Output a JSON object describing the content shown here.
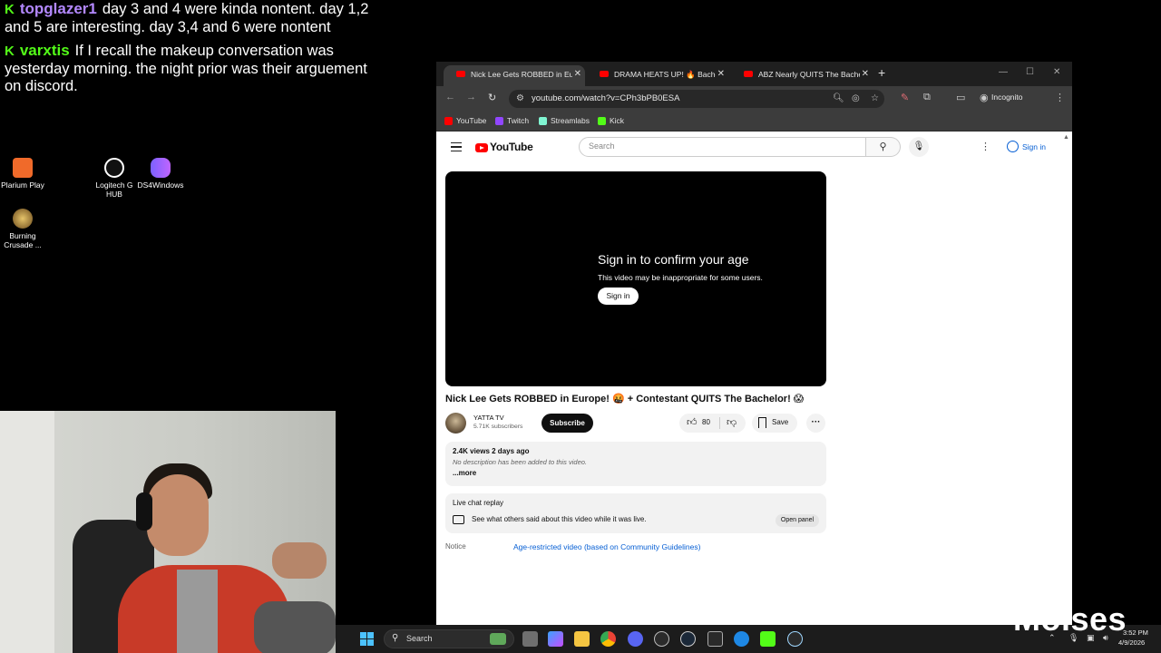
{
  "chat": {
    "messages": [
      {
        "user": "topglazer1",
        "text": "day 3 and 4 were kinda nontent. day 1,2 and 5 are interesting. day 3,4 and 6 were nontent"
      },
      {
        "user": "varxtis",
        "text": "If I recall the makeup conversation was yesterday morning. the night prior was their arguement on discord."
      }
    ]
  },
  "desktop": {
    "icons": [
      {
        "label": "Plarium Play",
        "color": "#f06a2a"
      },
      {
        "label": "Logitech G HUB",
        "color": "#ffffff"
      },
      {
        "label": "DS4Windows",
        "color": "#7b61ff"
      },
      {
        "label": "Burning Crusade ...",
        "color": "#c9a24b"
      }
    ]
  },
  "browser": {
    "tabs": [
      {
        "title": "Nick Lee Gets ROBBED in Europe!",
        "active": true
      },
      {
        "title": "DRAMA HEATS UP! 🔥 Bachelor",
        "active": false
      },
      {
        "title": "ABZ Nearly QUITS The Bachelor",
        "active": false
      }
    ],
    "new_tab": "+",
    "url": "youtube.com/watch?v=CPh3bPB0ESA",
    "incognito_label": "Incognito",
    "bookmarks": [
      {
        "label": "YouTube",
        "color": "#ff0000"
      },
      {
        "label": "Twitch",
        "color": "#9146ff"
      },
      {
        "label": "Streamlabs",
        "color": "#80f5d2"
      },
      {
        "label": "Kick",
        "color": "#53fc18"
      }
    ]
  },
  "youtube": {
    "logo_text": "YouTube",
    "search_placeholder": "Search",
    "sign_in_label": "Sign in",
    "player": {
      "title": "Sign in to confirm your age",
      "subtitle": "This video may be inappropriate for some users.",
      "button": "Sign in"
    },
    "video_title": "Nick Lee Gets ROBBED in Europe! 🤬 + Contestant QUITS The Bachelor! 😱",
    "channel": {
      "name": "YATTA TV",
      "subscribers": "5.71K subscribers"
    },
    "subscribe_label": "Subscribe",
    "like_count": "80",
    "save_label": "Save",
    "description": {
      "stats": "2.4K views  2 days ago",
      "text": "No description has been added to this video.",
      "more": "...more"
    },
    "live_chat": {
      "title": "Live chat replay",
      "text": "See what others said about this video while it was live.",
      "button": "Open panel"
    },
    "notice": {
      "label": "Notice",
      "link": "Age-restricted video (based on Community Guidelines)"
    }
  },
  "taskbar": {
    "search_label": "Search",
    "time": "3:52 PM",
    "date": "4/9/2026"
  },
  "watermark": "Moises"
}
